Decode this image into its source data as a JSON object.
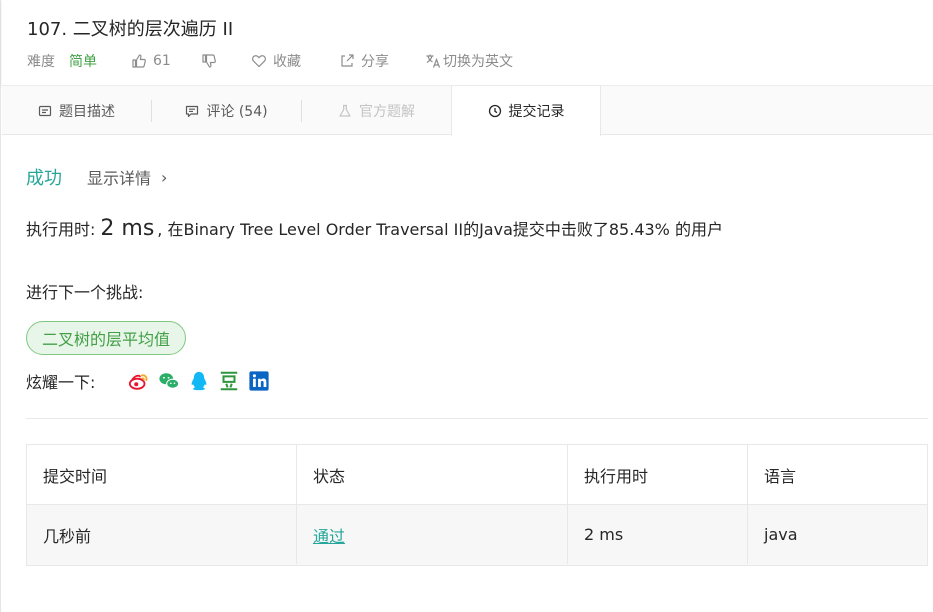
{
  "header": {
    "title": "107. 二叉树的层次遍历 II",
    "difficulty_label": "难度",
    "difficulty_value": "简单",
    "likes": "61",
    "collect_label": "收藏",
    "share_label": "分享",
    "translate_label": "切换为英文"
  },
  "tabs": [
    {
      "label": "题目描述",
      "icon": "description-icon",
      "state": "normal"
    },
    {
      "label": "评论 (54)",
      "icon": "comment-icon",
      "state": "normal"
    },
    {
      "label": "官方题解",
      "icon": "flask-icon",
      "state": "disabled"
    },
    {
      "label": "提交记录",
      "icon": "clock-icon",
      "state": "active"
    }
  ],
  "result": {
    "status": "成功",
    "details_label": "显示详情",
    "runtime_prefix": "执行用时:",
    "runtime_value": "2 ms",
    "runtime_suffix": ", 在Binary Tree Level Order Traversal II的Java提交中击败了85.43% 的用户",
    "next_challenge_label": "进行下一个挑战:",
    "next_challenge": "二叉树的层平均值",
    "share_prompt": "炫耀一下:",
    "share_icons": [
      "weibo-icon",
      "wechat-icon",
      "qq-icon",
      "douban-icon",
      "linkedin-icon"
    ]
  },
  "table": {
    "headers": [
      "提交时间",
      "状态",
      "执行用时",
      "语言"
    ],
    "rows": [
      {
        "time": "几秒前",
        "status": "通过",
        "runtime": "2 ms",
        "language": "java"
      }
    ]
  },
  "colors": {
    "accent": "#26a69a",
    "easy": "#43a047",
    "challenge_bg": "#e8f5e9",
    "challenge_border": "#81c784"
  }
}
